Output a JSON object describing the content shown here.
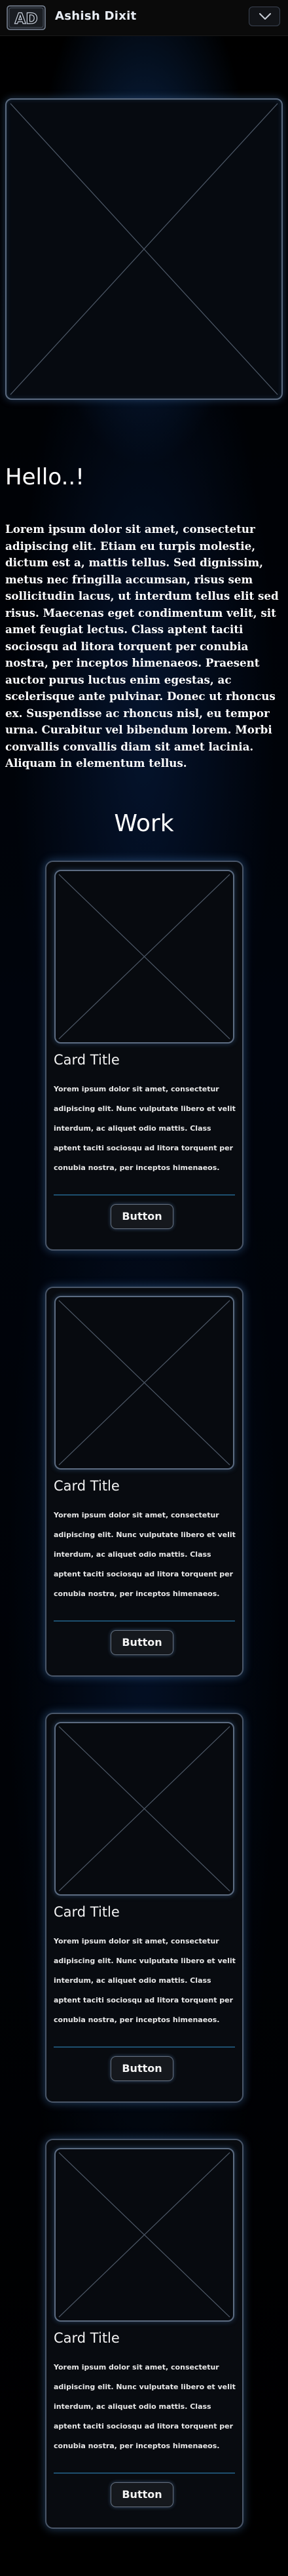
{
  "navbar": {
    "logo_text": "AD",
    "brand": "Ashish Dixit",
    "toggle_icon": "chevron-down-icon"
  },
  "hero": {
    "image_icon": "image-placeholder-icon"
  },
  "about": {
    "greeting": "Hello..!",
    "text": "Lorem ipsum dolor sit amet, consectetur adipiscing elit. Etiam eu turpis molestie, dictum est a, mattis tellus. Sed dignissim, metus nec fringilla accumsan, risus sem sollicitudin lacus, ut interdum tellus elit sed risus. Maecenas eget condimentum velit, sit amet feugiat lectus. Class aptent taciti sociosqu ad litora torquent per conubia nostra, per inceptos himenaeos. Praesent auctor purus luctus enim egestas, ac scelerisque ante pulvinar. Donec ut rhoncus ex. Suspendisse ac rhoncus nisl, eu tempor urna. Curabitur vel bibendum lorem. Morbi convallis convallis diam sit amet lacinia. Aliquam in elementum tellus."
  },
  "work": {
    "title": "Work",
    "cards": [
      {
        "title": "Card Title",
        "text": "Yorem ipsum dolor sit amet, consectetur adipiscing elit. Nunc vulputate libero et velit interdum, ac aliquet odio mattis. Class aptent taciti sociosqu ad litora torquent per conubia nostra, per inceptos himenaeos.",
        "button": "Button"
      },
      {
        "title": "Card Title",
        "text": "Yorem ipsum dolor sit amet, consectetur adipiscing elit. Nunc vulputate libero et velit interdum, ac aliquet odio mattis. Class aptent taciti sociosqu ad litora torquent per conubia nostra, per inceptos himenaeos.",
        "button": "Button"
      },
      {
        "title": "Card Title",
        "text": "Yorem ipsum dolor sit amet, consectetur adipiscing elit. Nunc vulputate libero et velit interdum, ac aliquet odio mattis. Class aptent taciti sociosqu ad litora torquent per conubia nostra, per inceptos himenaeos.",
        "button": "Button"
      },
      {
        "title": "Card Title",
        "text": "Yorem ipsum dolor sit amet, consectetur adipiscing elit. Nunc vulputate libero et velit interdum, ac aliquet odio mattis. Class aptent taciti sociosqu ad litora torquent per conubia nostra, per inceptos himenaeos.",
        "button": "Button"
      }
    ]
  },
  "colors": {
    "background": "#000000",
    "accent_glow": "#1c4a8c",
    "border": "#5c6b80",
    "divider": "#1d4f6e"
  }
}
